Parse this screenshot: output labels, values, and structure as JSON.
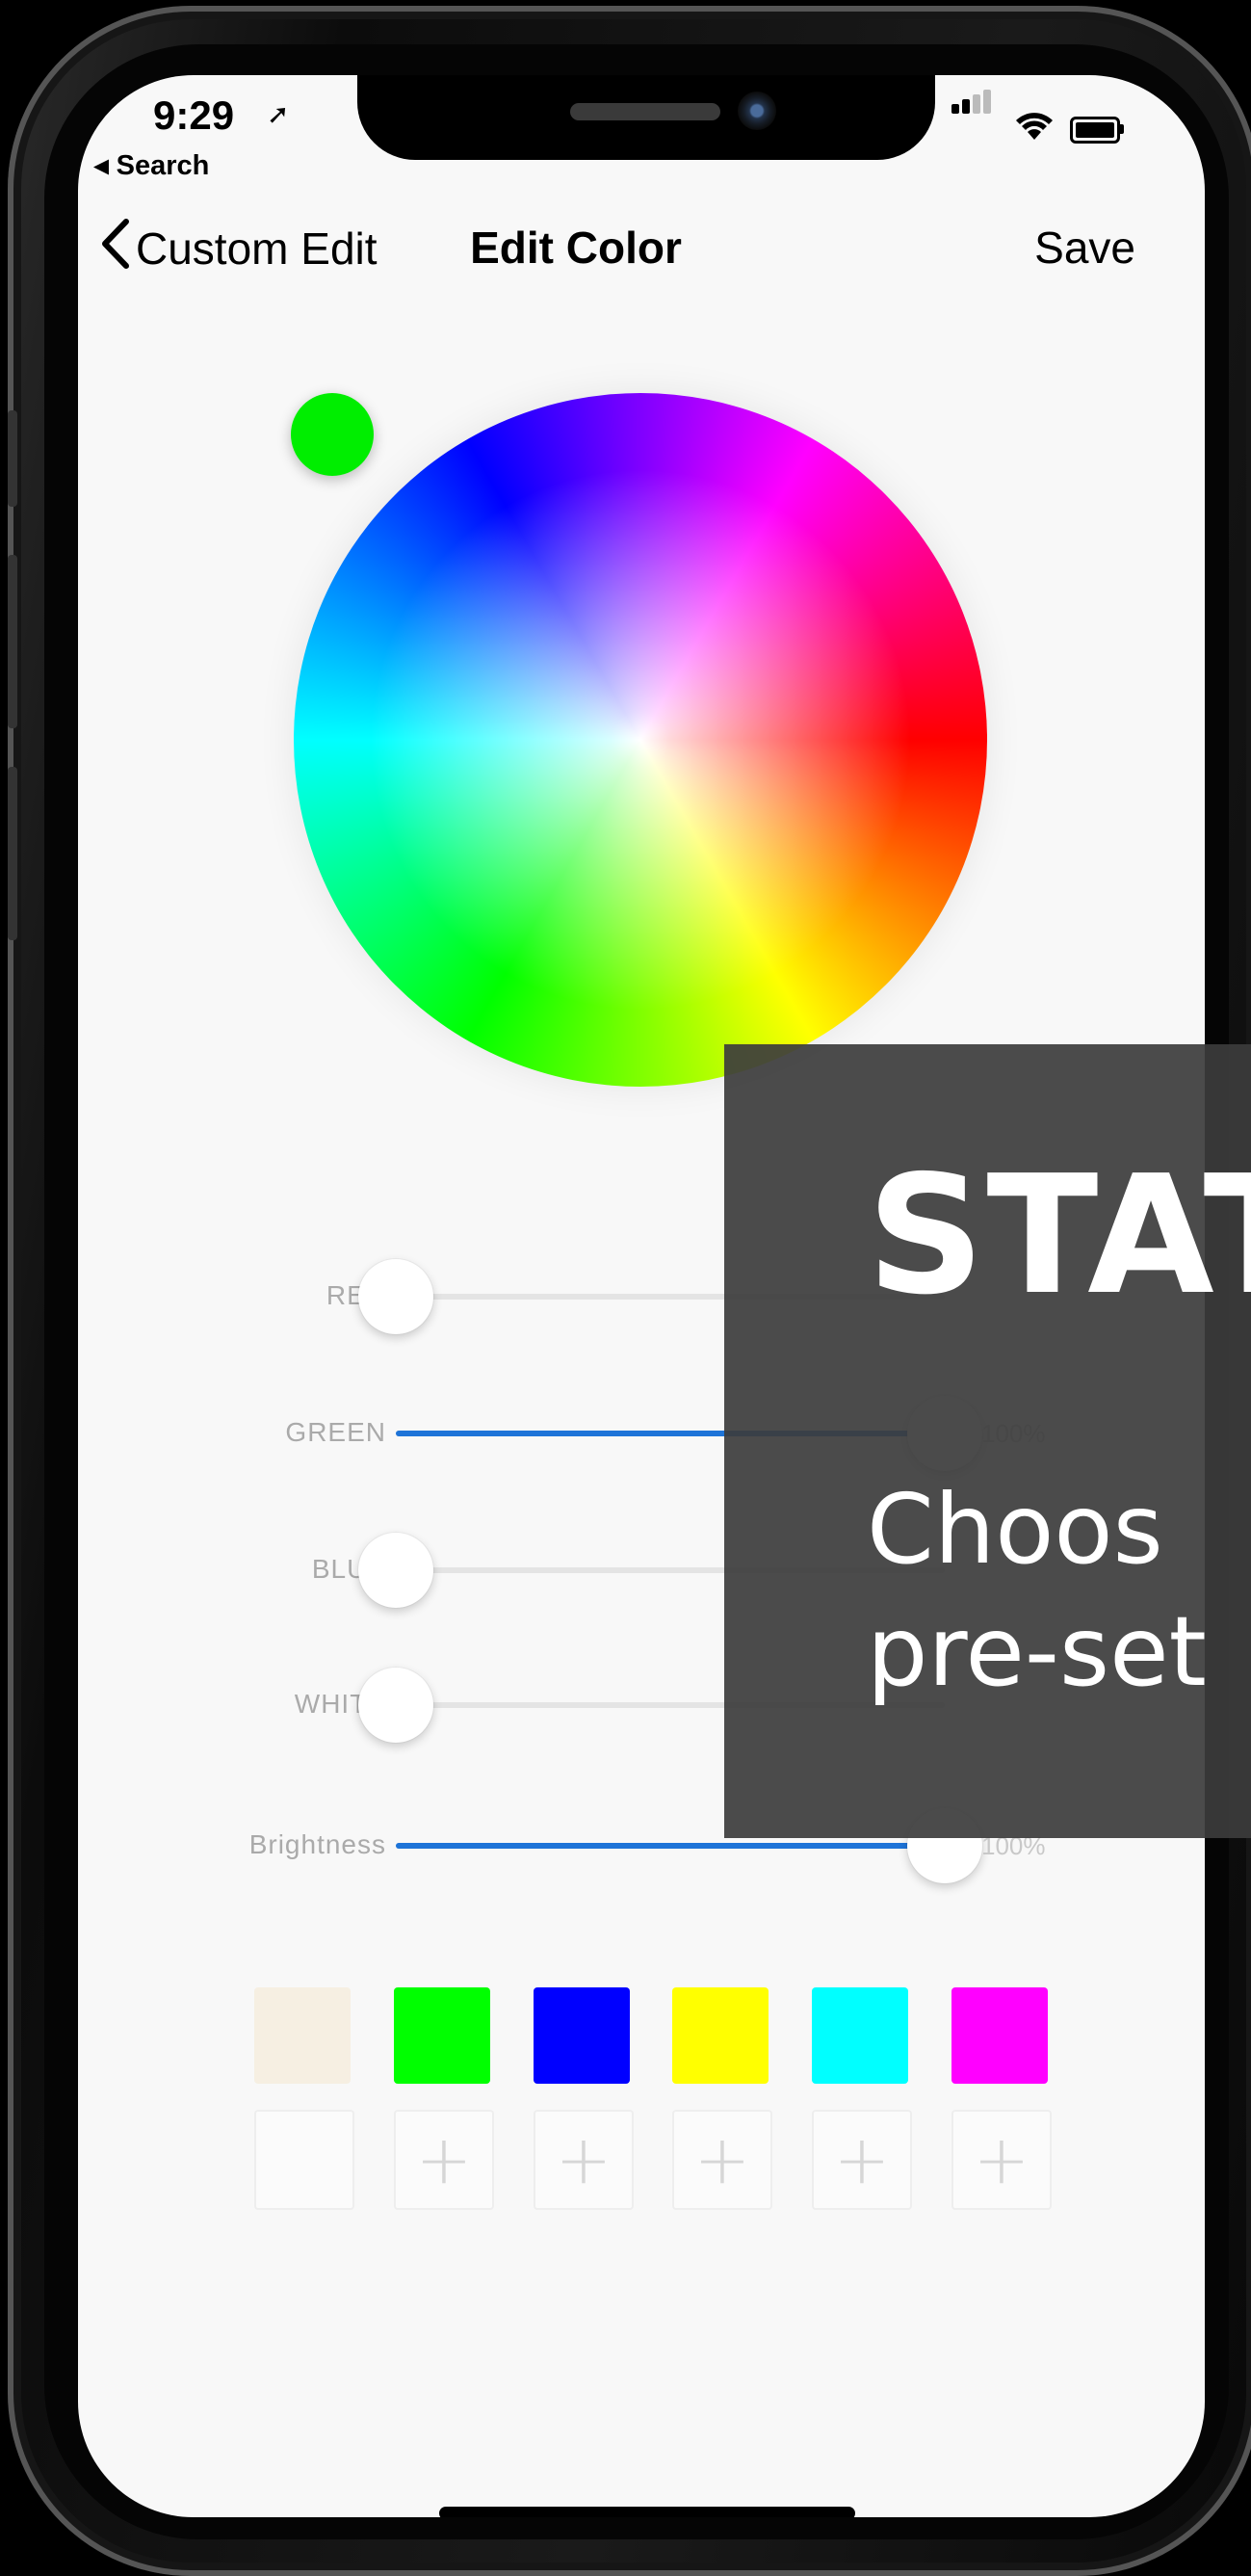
{
  "status_bar": {
    "time": "9:29",
    "back_app": "◂ Search",
    "location_icon": "location-arrow-icon",
    "signal_icon": "cellular-signal-icon",
    "wifi_icon": "wifi-icon",
    "battery_icon": "battery-icon"
  },
  "nav": {
    "back_label": "Custom Edit",
    "title": "Edit Color",
    "save_label": "Save"
  },
  "color_wheel": {
    "selected_color": "#00ee00"
  },
  "sliders": [
    {
      "label": "RED",
      "value_fraction": 0.0
    },
    {
      "label": "GREEN",
      "value_fraction": 1.0,
      "value_text": "100%"
    },
    {
      "label": "BLUE",
      "value_fraction": 0.0
    },
    {
      "label": "WHITE",
      "value_fraction": 0.0
    },
    {
      "label": "Brightness",
      "value_fraction": 1.0,
      "value_text": "100%"
    }
  ],
  "preset_colors": [
    "#f6efe2",
    "#00ff00",
    "#0000ff",
    "#ffff00",
    "#00ffff",
    "#ff00ff"
  ],
  "add_slots": 5,
  "overlay": {
    "title": "STAT",
    "line1": "Choos",
    "line2": "pre-set"
  },
  "colors": {
    "accent": "#1e74d8",
    "overlay_bg": "#3c3c3c"
  }
}
